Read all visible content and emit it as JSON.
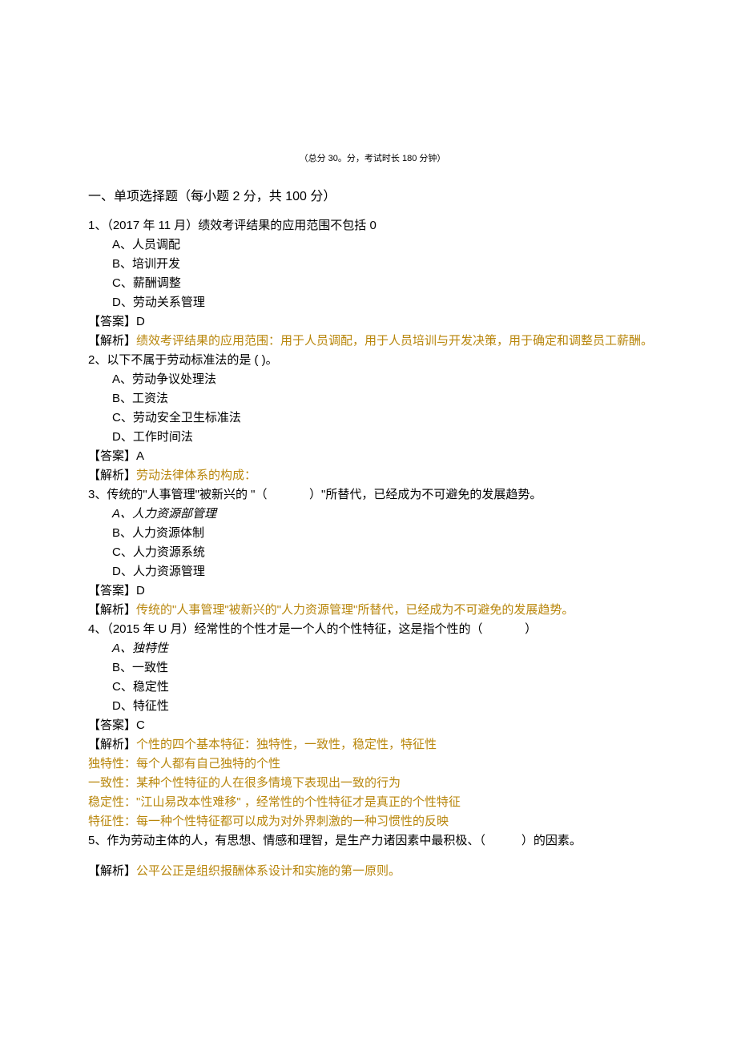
{
  "header": "（总分 30。分，考试时长 180 分钟）",
  "section_title": "一、单项选择题（每小题 2 分，共 100 分）",
  "q1": {
    "stem": "1、（2017 年 11 月）绩效考评结果的应用范围不包括 0",
    "a": "A、人员调配",
    "b": "B、培训开发",
    "c": "C、薪酬调整",
    "d": "D、劳动关系管理",
    "ans": "【答案】D",
    "ana_lead": "【解析】",
    "ana": "绩效考评结果的应用范围：用于人员调配，用于人员培训与开发决策，用于确定和调整员工薪酬。"
  },
  "q2": {
    "stem": "2、以下不属于劳动标准法的是 ( )。",
    "a": "A、劳动争议处理法",
    "b": "B、工资法",
    "c": "C、劳动安全卫生标准法",
    "d": "D、工作时间法",
    "ans": "【答案】A",
    "ana_lead": "【解析】",
    "ana": "劳动法律体系的构成："
  },
  "q3": {
    "stem_a": "3、传统的\"人事管理\"被新兴的 \"（",
    "stem_b": "）\"所替代，已经成为不可避免的发展趋势。",
    "a": "A、人力资源部管理",
    "b": "B、人力资源体制",
    "c": "C、人力资源系统",
    "d": "D、人力资源管理",
    "ans": "【答案】D",
    "ana_lead": "【解析】",
    "ana": "传统的\"人事管理\"被新兴的\"人力资源管理\"所替代，已经成为不可避免的发展趋势。"
  },
  "q4": {
    "stem_a": "4、（2015 年 U 月）经常性的个性才是一个人的个性特征，这是指个性的（",
    "stem_b": "）",
    "a": "A、独特性",
    "b": "B、一致性",
    "c": "C、稳定性",
    "d": "D、特征性",
    "ans": "【答案】C",
    "ana_lead": "【解析】",
    "ana1": "个性的四个基本特征：独特性，一致性，稳定性，特征性",
    "ana2": "独特性：每个人都有自己独特的个性",
    "ana3": "一致性：某种个性特征的人在很多情境下表现出一致的行为",
    "ana4": "稳定性：\"江山易改本性难移\"  ，经常性的个性特征才是真正的个性特征",
    "ana5": "特征性：每一种个性特征都可以成为对外界刺激的一种习惯性的反映"
  },
  "q5": {
    "stem_a": "5、作为劳动主体的人，有思想、情感和理智，是生产力诸因素中最积极、（",
    "stem_b": "）的因素。",
    "ana_lead": "【解析】",
    "ana": "公平公正是组织报酬体系设计和实施的第一原则。"
  }
}
